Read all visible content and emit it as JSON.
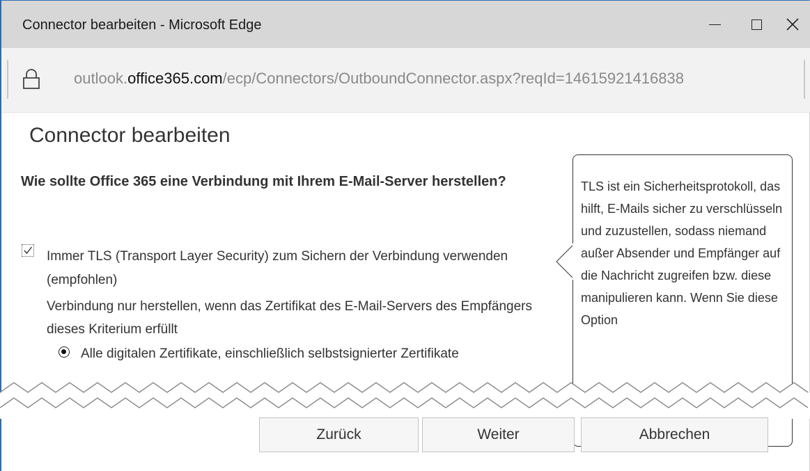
{
  "window": {
    "title": "Connector bearbeiten - Microsoft Edge",
    "close_glyph": "✕"
  },
  "address_bar": {
    "url_prefix": "outlook.",
    "url_domain": "office365.com",
    "url_path": "/ecp/Connectors/OutboundConnector.aspx?reqId=14615921416838",
    "lock_icon": "lock-icon"
  },
  "page": {
    "heading": "Connector bearbeiten",
    "question": "Wie sollte Office 365 eine Verbindung mit Ihrem E-Mail-Server herstellen?",
    "tls_checkbox": {
      "label": "Immer TLS (Transport Layer Security) zum Sichern der Verbindung verwenden (empfohlen)",
      "checked": true
    },
    "cert_condition": "Verbindung nur herstellen, wenn das Zertifikat des E-Mail-Servers des Empfängers dieses Kriterium erfüllt",
    "radio_option": {
      "label": "Alle digitalen Zertifikate, einschließlich selbstsignierter Zertifikate",
      "selected": true
    },
    "callout": {
      "text": "TLS ist ein Sicherheitsprotokoll, das hilft, E-Mails sicher zu verschlüsseln und zuzustellen, sodass niemand außer Absender und Empfänger auf die Nachricht zugreifen bzw. diese manipulieren kann. Wenn Sie diese Option"
    }
  },
  "buttons": {
    "back": "Zurück",
    "next": "Weiter",
    "cancel": "Abbrechen"
  }
}
